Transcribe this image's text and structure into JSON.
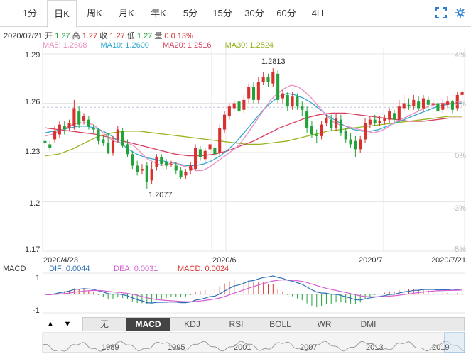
{
  "tabs": [
    "1分",
    "日K",
    "周K",
    "月K",
    "年K",
    "5分",
    "15分",
    "30分",
    "60分",
    "4H"
  ],
  "active_tab": "日K",
  "info": {
    "date": "2020/07/21",
    "open_label": "开",
    "open": "1.27",
    "high_label": "高",
    "high": "1.27",
    "close_label": "收",
    "close": "1.27",
    "low_label": "低",
    "low": "1.27",
    "vol_label": "量",
    "vol": "0",
    "pct": "0.13%"
  },
  "ma": [
    {
      "label": "MA5: 1.2608",
      "color": "#e98dbd"
    },
    {
      "label": "MA10: 1.2600",
      "color": "#2ea7d2"
    },
    {
      "label": "MA20: 1.2516",
      "color": "#d93f5f"
    },
    {
      "label": "MA30: 1.2524",
      "color": "#94b41f"
    }
  ],
  "y_labels": [
    "1.29",
    "1.26",
    "1.23",
    "1.2",
    "1.17"
  ],
  "pct_labels": [
    "4%",
    "2%",
    "0%",
    "-3%",
    "-5%"
  ],
  "x_labels": [
    "2020/4/23",
    "2020/6",
    "2020/7",
    "2020/7/21"
  ],
  "annotations": {
    "high": "1.2813",
    "low": "1.2077"
  },
  "macd": {
    "title": "MACD",
    "dif": "DIF: 0.0044",
    "dea": "DEA: 0.0031",
    "macd": "MACD: 0.0024",
    "ticks": [
      "1",
      "-1"
    ]
  },
  "indicators": [
    "无",
    "MACD",
    "KDJ",
    "RSI",
    "BOLL",
    "WR",
    "DMI"
  ],
  "active_indicator": "MACD",
  "nav": {
    "up": "▲",
    "down": "▼"
  },
  "overview_years": [
    "1989",
    "1995",
    "2001",
    "2007",
    "2013",
    "2019"
  ],
  "colors": {
    "up": "#d8322f",
    "down": "#22a33a",
    "grid": "#e6e6e6"
  },
  "chart_data": {
    "type": "candlestick",
    "ylim": [
      1.17,
      1.29
    ],
    "x_ticks": [
      "2020/4/23",
      "2020/6",
      "2020/7",
      "2020/7/21"
    ],
    "candles": [
      [
        1.237,
        1.236,
        1.239,
        1.232
      ],
      [
        1.235,
        1.233,
        1.237,
        1.231
      ],
      [
        1.238,
        1.243,
        1.246,
        1.236
      ],
      [
        1.241,
        1.247,
        1.249,
        1.239
      ],
      [
        1.246,
        1.244,
        1.249,
        1.241
      ],
      [
        1.245,
        1.248,
        1.25,
        1.243
      ],
      [
        1.246,
        1.257,
        1.262,
        1.244
      ],
      [
        1.255,
        1.247,
        1.258,
        1.245
      ],
      [
        1.249,
        1.252,
        1.254,
        1.247
      ],
      [
        1.25,
        1.246,
        1.252,
        1.244
      ],
      [
        1.245,
        1.244,
        1.247,
        1.242
      ],
      [
        1.244,
        1.237,
        1.245,
        1.235
      ],
      [
        1.238,
        1.236,
        1.24,
        1.234
      ],
      [
        1.236,
        1.23,
        1.242,
        1.229
      ],
      [
        1.23,
        1.237,
        1.24,
        1.228
      ],
      [
        1.238,
        1.244,
        1.246,
        1.236
      ],
      [
        1.243,
        1.234,
        1.245,
        1.233
      ],
      [
        1.235,
        1.229,
        1.238,
        1.227
      ],
      [
        1.229,
        1.222,
        1.231,
        1.22
      ],
      [
        1.222,
        1.218,
        1.225,
        1.216
      ],
      [
        1.219,
        1.22,
        1.223,
        1.217
      ],
      [
        1.222,
        1.212,
        1.224,
        1.2077
      ],
      [
        1.213,
        1.22,
        1.224,
        1.211
      ],
      [
        1.221,
        1.227,
        1.229,
        1.219
      ],
      [
        1.227,
        1.223,
        1.229,
        1.222
      ],
      [
        1.224,
        1.222,
        1.226,
        1.22
      ],
      [
        1.223,
        1.223,
        1.225,
        1.221
      ],
      [
        1.222,
        1.219,
        1.224,
        1.217
      ],
      [
        1.219,
        1.215,
        1.221,
        1.214
      ],
      [
        1.216,
        1.218,
        1.22,
        1.214
      ],
      [
        1.219,
        1.222,
        1.224,
        1.217
      ],
      [
        1.22,
        1.233,
        1.235,
        1.219
      ],
      [
        1.232,
        1.227,
        1.234,
        1.225
      ],
      [
        1.226,
        1.231,
        1.233,
        1.224
      ],
      [
        1.232,
        1.235,
        1.237,
        1.23
      ],
      [
        1.233,
        1.229,
        1.236,
        1.227
      ],
      [
        1.23,
        1.245,
        1.247,
        1.228
      ],
      [
        1.244,
        1.253,
        1.255,
        1.242
      ],
      [
        1.252,
        1.258,
        1.26,
        1.25
      ],
      [
        1.257,
        1.26,
        1.262,
        1.255
      ],
      [
        1.261,
        1.255,
        1.264,
        1.253
      ],
      [
        1.256,
        1.262,
        1.265,
        1.254
      ],
      [
        1.263,
        1.27,
        1.272,
        1.26
      ],
      [
        1.27,
        1.262,
        1.273,
        1.26
      ],
      [
        1.262,
        1.273,
        1.276,
        1.26
      ],
      [
        1.273,
        1.276,
        1.279,
        1.271
      ],
      [
        1.276,
        1.273,
        1.278,
        1.27
      ],
      [
        1.272,
        1.279,
        1.2813,
        1.27
      ],
      [
        1.278,
        1.262,
        1.28,
        1.26
      ],
      [
        1.263,
        1.266,
        1.268,
        1.26
      ],
      [
        1.265,
        1.258,
        1.267,
        1.255
      ],
      [
        1.258,
        1.264,
        1.267,
        1.256
      ],
      [
        1.264,
        1.258,
        1.266,
        1.256
      ],
      [
        1.258,
        1.256,
        1.261,
        1.252
      ],
      [
        1.255,
        1.245,
        1.258,
        1.242
      ],
      [
        1.246,
        1.241,
        1.249,
        1.239
      ],
      [
        1.241,
        1.24,
        1.244,
        1.236
      ],
      [
        1.24,
        1.247,
        1.249,
        1.238
      ],
      [
        1.248,
        1.251,
        1.253,
        1.246
      ],
      [
        1.25,
        1.245,
        1.253,
        1.243
      ],
      [
        1.245,
        1.251,
        1.254,
        1.243
      ],
      [
        1.25,
        1.242,
        1.253,
        1.24
      ],
      [
        1.243,
        1.238,
        1.245,
        1.236
      ],
      [
        1.238,
        1.235,
        1.242,
        1.233
      ],
      [
        1.237,
        1.232,
        1.24,
        1.227
      ],
      [
        1.232,
        1.238,
        1.24,
        1.23
      ],
      [
        1.238,
        1.248,
        1.251,
        1.236
      ],
      [
        1.247,
        1.25,
        1.252,
        1.245
      ],
      [
        1.25,
        1.248,
        1.253,
        1.246
      ],
      [
        1.248,
        1.249,
        1.252,
        1.246
      ],
      [
        1.249,
        1.251,
        1.253,
        1.247
      ],
      [
        1.25,
        1.255,
        1.257,
        1.248
      ],
      [
        1.254,
        1.25,
        1.256,
        1.248
      ],
      [
        1.25,
        1.258,
        1.262,
        1.249
      ],
      [
        1.257,
        1.26,
        1.265,
        1.255
      ],
      [
        1.259,
        1.258,
        1.263,
        1.256
      ],
      [
        1.258,
        1.262,
        1.265,
        1.256
      ],
      [
        1.261,
        1.257,
        1.264,
        1.255
      ],
      [
        1.257,
        1.263,
        1.265,
        1.255
      ],
      [
        1.262,
        1.259,
        1.264,
        1.257
      ],
      [
        1.259,
        1.26,
        1.263,
        1.257
      ],
      [
        1.26,
        1.255,
        1.262,
        1.254
      ],
      [
        1.256,
        1.26,
        1.262,
        1.254
      ],
      [
        1.259,
        1.261,
        1.264,
        1.257
      ],
      [
        1.261,
        1.256,
        1.262,
        1.254
      ],
      [
        1.257,
        1.265,
        1.267,
        1.255
      ],
      [
        1.265,
        1.267,
        1.268,
        1.263
      ]
    ],
    "ma5": [
      1.24,
      1.241,
      1.243,
      1.245,
      1.247,
      1.248,
      1.248,
      1.247,
      1.244,
      1.24,
      1.237,
      1.236,
      1.236,
      1.234,
      1.23,
      1.226,
      1.224,
      1.222,
      1.223,
      1.224,
      1.222,
      1.221,
      1.219,
      1.219,
      1.221,
      1.224,
      1.227,
      1.23,
      1.233,
      1.238,
      1.244,
      1.25,
      1.256,
      1.262,
      1.266,
      1.269,
      1.271,
      1.27,
      1.267,
      1.263,
      1.258,
      1.253,
      1.249,
      1.247,
      1.246,
      1.245,
      1.244,
      1.243,
      1.242,
      1.243,
      1.245,
      1.248,
      1.25,
      1.252,
      1.254,
      1.256,
      1.258,
      1.259,
      1.26,
      1.26,
      1.26,
      1.261
    ],
    "ma10": [
      1.242,
      1.243,
      1.244,
      1.245,
      1.246,
      1.246,
      1.245,
      1.243,
      1.24,
      1.236,
      1.232,
      1.229,
      1.227,
      1.226,
      1.225,
      1.224,
      1.223,
      1.222,
      1.222,
      1.223,
      1.225,
      1.228,
      1.232,
      1.237,
      1.243,
      1.249,
      1.255,
      1.26,
      1.264,
      1.266,
      1.265,
      1.263,
      1.26,
      1.256,
      1.252,
      1.249,
      1.246,
      1.244,
      1.243,
      1.243,
      1.244,
      1.246,
      1.248,
      1.25,
      1.252,
      1.254,
      1.256,
      1.258,
      1.259,
      1.26,
      1.26
    ],
    "ma20": [
      1.245,
      1.244,
      1.243,
      1.242,
      1.241,
      1.239,
      1.237,
      1.235,
      1.233,
      1.231,
      1.229,
      1.228,
      1.228,
      1.229,
      1.231,
      1.234,
      1.237,
      1.241,
      1.245,
      1.248,
      1.251,
      1.253,
      1.254,
      1.254,
      1.253,
      1.252,
      1.251,
      1.25,
      1.249,
      1.249,
      1.25,
      1.251,
      1.251
    ],
    "ma30": [
      1.228,
      1.229,
      1.232,
      1.236,
      1.24,
      1.242,
      1.243,
      1.243,
      1.242,
      1.241,
      1.24,
      1.239,
      1.238,
      1.237,
      1.236,
      1.235,
      1.235,
      1.236,
      1.237,
      1.239,
      1.241,
      1.243,
      1.244,
      1.245,
      1.246,
      1.247,
      1.248,
      1.249,
      1.25,
      1.251,
      1.252,
      1.252
    ]
  }
}
